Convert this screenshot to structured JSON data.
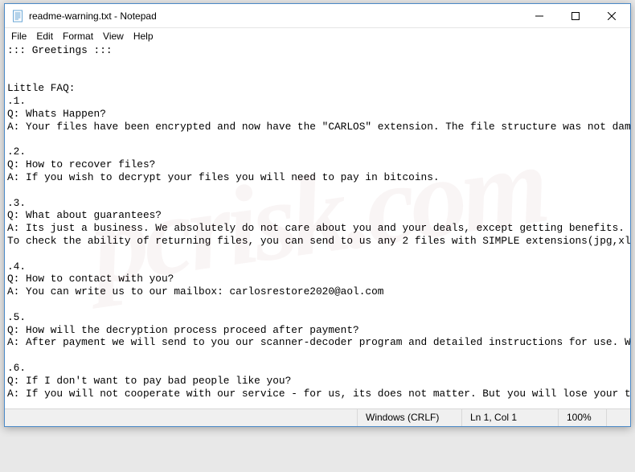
{
  "window": {
    "title": "readme-warning.txt - Notepad"
  },
  "menu": {
    "file": "File",
    "edit": "Edit",
    "format": "Format",
    "view": "View",
    "help": "Help"
  },
  "content": "::: Greetings :::\n\n\nLittle FAQ:\n.1.\nQ: Whats Happen?\nA: Your files have been encrypted and now have the \"CARLOS\" extension. The file structure was not damaged\n\n.2.\nQ: How to recover files?\nA: If you wish to decrypt your files you will need to pay in bitcoins.\n\n.3.\nQ: What about guarantees?\nA: Its just a business. We absolutely do not care about you and your deals, except getting benefits. If w\nTo check the ability of returning files, you can send to us any 2 files with SIMPLE extensions(jpg,xls,do\n\n.4.\nQ: How to contact with you?\nA: You can write us to our mailbox: carlosrestore2020@aol.com\n\n.5.\nQ: How will the decryption process proceed after payment?\nA: After payment we will send to you our scanner-decoder program and detailed instructions for use. With \n\n.6.\nQ: If I don't want to pay bad people like you?\nA: If you will not cooperate with our service - for us, its does not matter. But you will lose your time ",
  "status": {
    "crlf": "Windows (CRLF)",
    "pos": "Ln 1, Col 1",
    "zoom": "100%"
  },
  "icons": {
    "minimize": "—",
    "maximize": "☐",
    "close": "✕"
  }
}
